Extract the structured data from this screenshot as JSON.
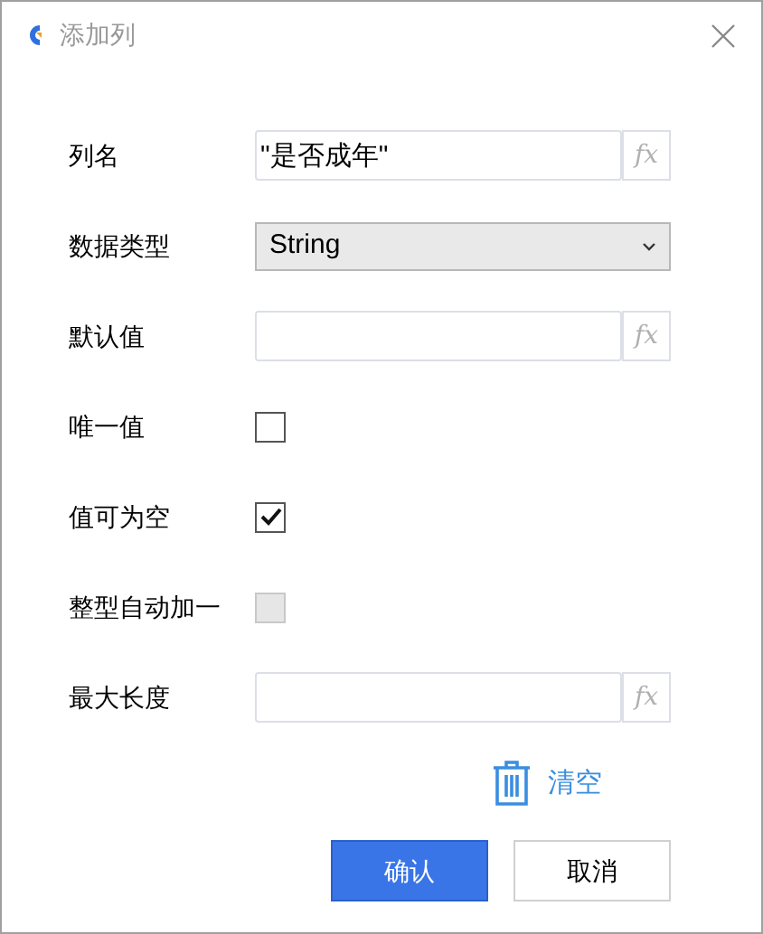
{
  "window": {
    "title": "添加列"
  },
  "fields": [
    {
      "kind": "text",
      "label": "列名",
      "value": "\"是否成年\"",
      "fx": "fx"
    },
    {
      "kind": "select",
      "label": "数据类型",
      "value": "String"
    },
    {
      "kind": "text",
      "label": "默认值",
      "fx": "fx"
    },
    {
      "kind": "checkbox",
      "label": "唯一值",
      "checked": false,
      "disabled": false
    },
    {
      "kind": "checkbox",
      "label": "值可为空",
      "checked": true,
      "disabled": false
    },
    {
      "kind": "checkbox",
      "label": "整型自动加一",
      "checked": false,
      "disabled": true
    },
    {
      "kind": "text",
      "label": "最大长度",
      "fx": "fx"
    }
  ],
  "clear_button": "清空",
  "buttons": [
    {
      "label": "确认",
      "primary": true
    },
    {
      "label": "取消",
      "primary": false
    }
  ]
}
